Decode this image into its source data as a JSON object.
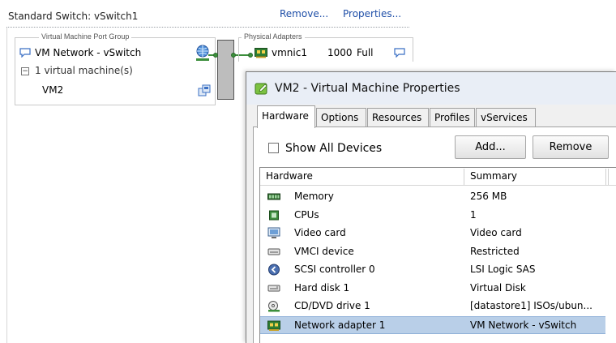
{
  "vswitch": {
    "title": "Standard Switch: vSwitch1",
    "remove_link": "Remove...",
    "properties_link": "Properties...",
    "port_group": {
      "legend": "Virtual Machine Port Group",
      "name": "VM Network - vSwitch",
      "expander": "−",
      "vm_count": "1 virtual machine(s)",
      "vm_name": "VM2"
    },
    "physical_adapters": {
      "legend": "Physical Adapters",
      "nic_name": "vmnic1",
      "speed": "1000",
      "duplex": "Full"
    }
  },
  "dialog": {
    "title": "VM2 - Virtual Machine Properties",
    "tabs": [
      {
        "label": "Hardware",
        "active": true
      },
      {
        "label": "Options",
        "active": false
      },
      {
        "label": "Resources",
        "active": false
      },
      {
        "label": "Profiles",
        "active": false
      },
      {
        "label": "vServices",
        "active": false
      }
    ],
    "show_all_devices_label": "Show All Devices",
    "show_all_devices_checked": false,
    "add_button": "Add...",
    "remove_button": "Remove",
    "table": {
      "columns": [
        "Hardware",
        "Summary"
      ],
      "rows": [
        {
          "icon": "memory-icon",
          "name": "Memory",
          "summary": "256 MB"
        },
        {
          "icon": "cpu-icon",
          "name": "CPUs",
          "summary": "1"
        },
        {
          "icon": "video-card-icon",
          "name": "Video card",
          "summary": "Video card"
        },
        {
          "icon": "vmci-device-icon",
          "name": "VMCI device",
          "summary": "Restricted"
        },
        {
          "icon": "scsi-controller-icon",
          "name": "SCSI controller 0",
          "summary": "LSI Logic SAS"
        },
        {
          "icon": "hard-disk-icon",
          "name": "Hard disk 1",
          "summary": "Virtual Disk"
        },
        {
          "icon": "cd-dvd-icon",
          "name": "CD/DVD drive 1",
          "summary": "[datastore1] ISOs/ubun..."
        },
        {
          "icon": "network-adapter-icon",
          "name": "Network adapter 1",
          "summary": "VM Network - vSwitch",
          "selected": true
        }
      ]
    }
  },
  "colors": {
    "link": "#1f4fa8",
    "wire": "#3c8f3c",
    "selection": "#b9cfe8"
  }
}
